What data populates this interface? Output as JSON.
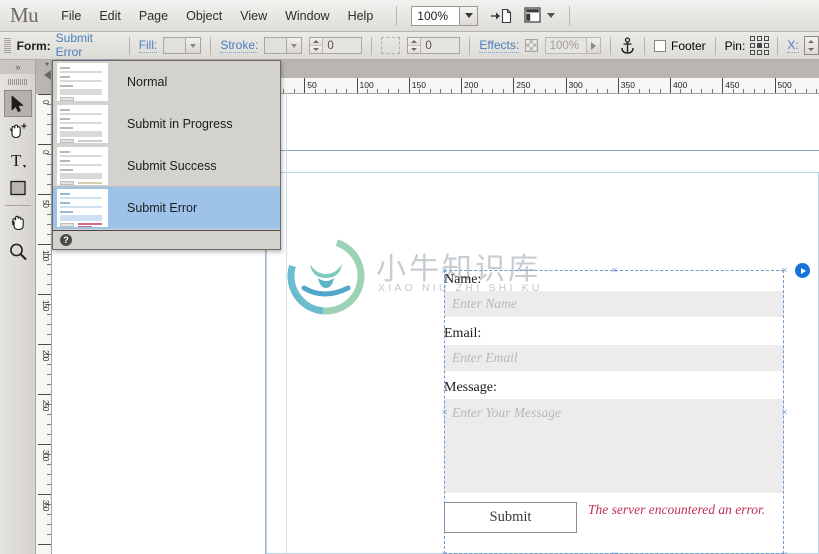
{
  "app": {
    "logo": "Mu",
    "zoom_level": "100%"
  },
  "menubar": {
    "items": [
      "File",
      "Edit",
      "Page",
      "Object",
      "View",
      "Window",
      "Help"
    ],
    "icons": [
      "add-page-icon",
      "layout-grid-icon"
    ]
  },
  "optionbar": {
    "form_label": "Form:",
    "form_state": "Submit Error",
    "fill_label": "Fill:",
    "stroke_label": "Stroke:",
    "stroke_weight": "0",
    "corner_radius": "0",
    "effects_label": "Effects:",
    "effects_opacity": "100%",
    "anchor_icon": "anchor-icon",
    "footer_label": "Footer",
    "footer_checked": false,
    "pin_label": "Pin:",
    "x_label": "X:"
  },
  "tools": [
    {
      "name": "selection-tool",
      "active": true
    },
    {
      "name": "crop-tool",
      "active": false
    },
    {
      "name": "text-tool",
      "active": false
    },
    {
      "name": "rectangle-tool",
      "active": false
    },
    {
      "name": "hand-tool",
      "active": false
    },
    {
      "name": "zoom-tool",
      "active": false
    }
  ],
  "rulers": {
    "horizontal_ticks": [
      "50",
      "100",
      "150",
      "200",
      "250",
      "300",
      "350",
      "400",
      "450",
      "500"
    ],
    "vertical_ticks": [
      "0",
      "0",
      "50",
      "100",
      "150",
      "200",
      "250",
      "300",
      "350"
    ],
    "corner_marker": "*"
  },
  "states_menu": {
    "items": [
      {
        "label": "Normal",
        "selected": false,
        "state": "normal"
      },
      {
        "label": "Submit in Progress",
        "selected": false,
        "state": "progress"
      },
      {
        "label": "Submit Success",
        "selected": false,
        "state": "success"
      },
      {
        "label": "Submit Error",
        "selected": true,
        "state": "error"
      }
    ],
    "help_icon": "help-icon"
  },
  "watermark": {
    "chinese": "小牛知识库",
    "pinyin": "XIAO NIU ZHI SHI KU",
    "logo": "bull-circle-logo"
  },
  "form_widget": {
    "fields": [
      {
        "label": "Name:",
        "placeholder": "Enter Name",
        "type": "input"
      },
      {
        "label": "Email:",
        "placeholder": "Enter Email",
        "type": "input"
      },
      {
        "label": "Message:",
        "placeholder": "Enter Your Message",
        "type": "textarea"
      }
    ],
    "submit_label": "Submit",
    "error_message": "The server encountered an error.",
    "play_icon": "play-preview-icon"
  },
  "colors": {
    "accent_link": "#4a7ebb",
    "selection_blue": "#9dc3ea",
    "error_red": "#c23055",
    "guide_blue": "#8fa2c4",
    "play_blue": "#1573d8",
    "field_gray": "#ececec"
  }
}
